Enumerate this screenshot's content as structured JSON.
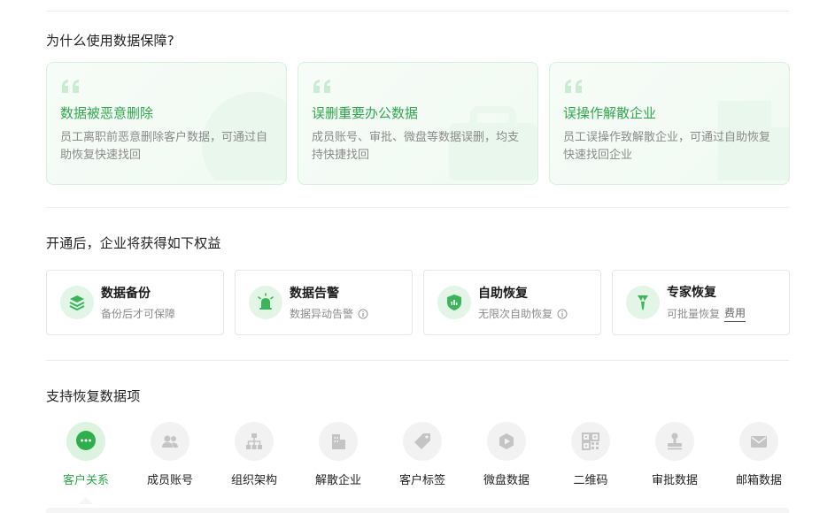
{
  "why": {
    "title": "为什么使用数据保障?",
    "cards": [
      {
        "title": "数据被恶意删除",
        "desc": "员工离职前恶意删除客户数据，可通过自助恢复快速找回"
      },
      {
        "title": "误删重要办公数据",
        "desc": "成员账号、审批、微盘等数据误删，均支持快捷找回"
      },
      {
        "title": "误操作解散企业",
        "desc": "员工误操作致解散企业，可通过自助恢复快速找回企业"
      }
    ]
  },
  "benefits": {
    "title": "开通后，企业将获得如下权益",
    "cards": [
      {
        "title": "数据备份",
        "desc": "备份后才可保障",
        "icon": "layers-icon"
      },
      {
        "title": "数据告警",
        "desc": "数据异动告警",
        "icon": "alarm-icon"
      },
      {
        "title": "自助恢复",
        "desc": "无限次自助恢复",
        "icon": "shield-chart-icon"
      },
      {
        "title": "专家恢复",
        "desc": "可批量恢复",
        "link": "费用",
        "icon": "expert-icon"
      }
    ]
  },
  "items": {
    "title": "支持恢复数据项",
    "list": [
      {
        "label": "客户关系",
        "icon": "chat-icon",
        "active": true
      },
      {
        "label": "成员账号",
        "icon": "members-icon"
      },
      {
        "label": "组织架构",
        "icon": "org-chart-icon"
      },
      {
        "label": "解散企业",
        "icon": "building-icon"
      },
      {
        "label": "客户标签",
        "icon": "tag-icon"
      },
      {
        "label": "微盘数据",
        "icon": "drive-icon"
      },
      {
        "label": "二维码",
        "icon": "qrcode-icon"
      },
      {
        "label": "审批数据",
        "icon": "stamp-icon"
      },
      {
        "label": "邮箱数据",
        "icon": "mail-icon"
      }
    ]
  },
  "colors": {
    "accent": "#2ea84a",
    "accent_light": "#e3f5e6",
    "card_border": "#d9f0dd"
  }
}
